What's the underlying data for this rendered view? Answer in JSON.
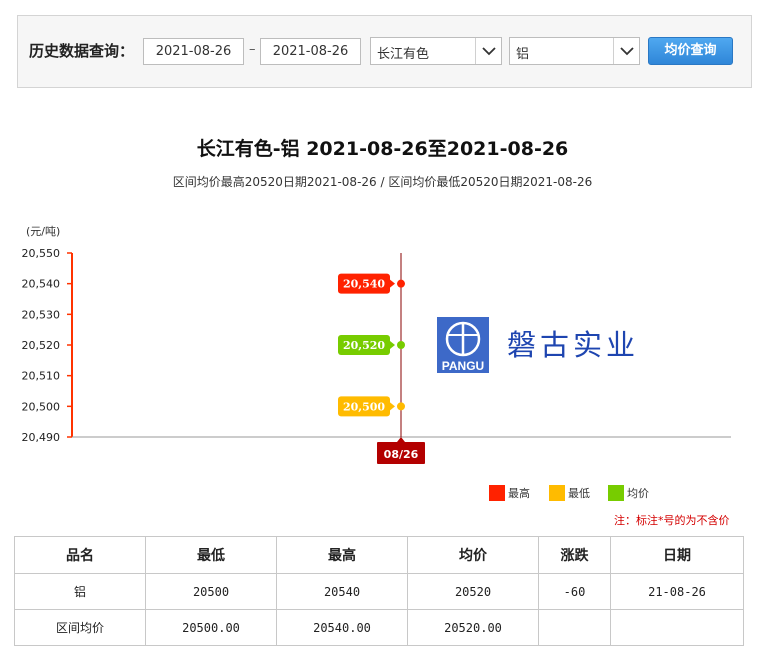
{
  "query": {
    "label": "历史数据查询：",
    "start_date": "2021-08-26",
    "separator": "–",
    "end_date": "2021-08-26",
    "market": "长江有色",
    "product": "铝",
    "button_label": "均价查询"
  },
  "chart_header": {
    "title": "长江有色-铝 2021-08-26至2021-08-26",
    "subtitle": "区间均价最高20520日期2021-08-26 / 区间均价最低20520日期2021-08-26",
    "unit": "(元/吨)"
  },
  "watermark": {
    "logo_text": "PANGU",
    "company": "磐古实业"
  },
  "chart_data": {
    "type": "line",
    "ylabel": "(元/吨)",
    "ylim": [
      20490,
      20550
    ],
    "yticks": [
      "20,550",
      "20,540",
      "20,530",
      "20,520",
      "20,510",
      "20,500",
      "20,490"
    ],
    "ytick_values": [
      20550,
      20540,
      20530,
      20520,
      20510,
      20500,
      20490
    ],
    "categories": [
      "08/26"
    ],
    "series": [
      {
        "name": "最高",
        "color": "#ff2200",
        "values": [
          20540
        ],
        "label": "20,540"
      },
      {
        "name": "最低",
        "color": "#ffbb00",
        "values": [
          20500
        ],
        "label": "20,500"
      },
      {
        "name": "均价",
        "color": "#77cc00",
        "values": [
          20520
        ],
        "label": "20,520"
      }
    ],
    "legend_position": "bottom-right"
  },
  "legend": [
    {
      "name": "最高",
      "color": "#ff2200"
    },
    {
      "name": "最低",
      "color": "#ffbb00"
    },
    {
      "name": "均价",
      "color": "#77cc00"
    }
  ],
  "note": "注：标注*号的为不含价",
  "table": {
    "headers": [
      "品名",
      "最低",
      "最高",
      "均价",
      "涨跌",
      "日期"
    ],
    "rows": [
      [
        "铝",
        "20500",
        "20540",
        "20520",
        "-60",
        "21-08-26"
      ],
      [
        "区间均价",
        "20500.00",
        "20540.00",
        "20520.00",
        "",
        ""
      ]
    ]
  }
}
